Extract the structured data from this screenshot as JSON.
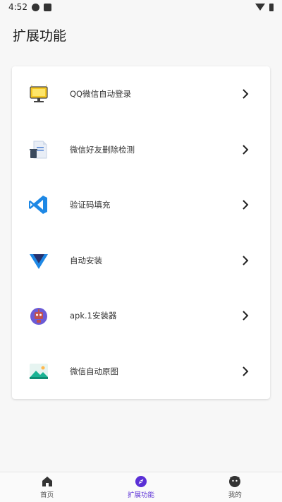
{
  "status": {
    "time": "4:52"
  },
  "page": {
    "title": "扩展功能"
  },
  "items": [
    {
      "label": "QQ微信自动登录",
      "icon": "monitor-icon"
    },
    {
      "label": "微信好友删除检测",
      "icon": "document-trash-icon"
    },
    {
      "label": "验证码填充",
      "icon": "vscode-icon"
    },
    {
      "label": "自动安装",
      "icon": "triangle-icon"
    },
    {
      "label": "apk.1安装器",
      "icon": "robot-icon"
    },
    {
      "label": "微信自动原图",
      "icon": "image-icon"
    }
  ],
  "tabs": [
    {
      "label": "首页",
      "icon": "home-icon",
      "active": false
    },
    {
      "label": "扩展功能",
      "icon": "compass-icon",
      "active": true
    },
    {
      "label": "我的",
      "icon": "face-icon",
      "active": false
    }
  ],
  "colors": {
    "accent": "#5a2fd6",
    "background": "#f7f7f7",
    "card": "#ffffff"
  }
}
